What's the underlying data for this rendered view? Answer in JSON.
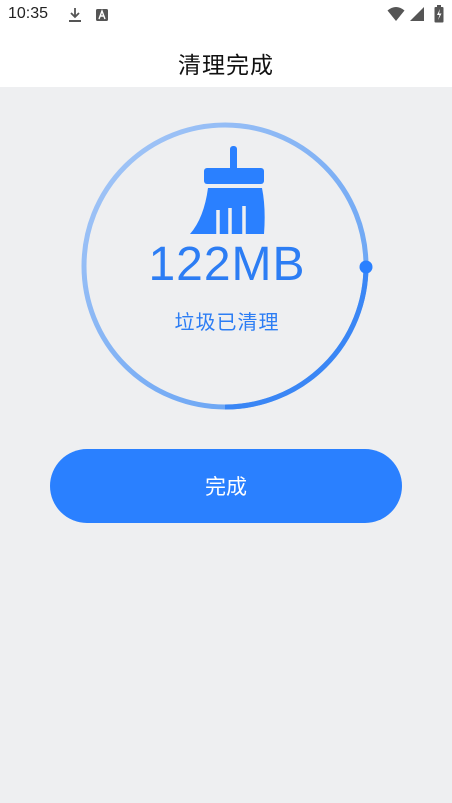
{
  "status_bar": {
    "time": "10:35",
    "icons": [
      "download-icon",
      "a-badge-icon",
      "wifi-icon",
      "signal-icon",
      "battery-icon"
    ]
  },
  "header": {
    "title": "清理完成"
  },
  "result": {
    "size": "122MB",
    "message": "垃圾已清理",
    "progress": 1.0
  },
  "actions": {
    "done_label": "完成"
  },
  "colors": {
    "accent": "#2a80ff",
    "text_blue": "#2c7df4",
    "background": "#eeeff1"
  }
}
